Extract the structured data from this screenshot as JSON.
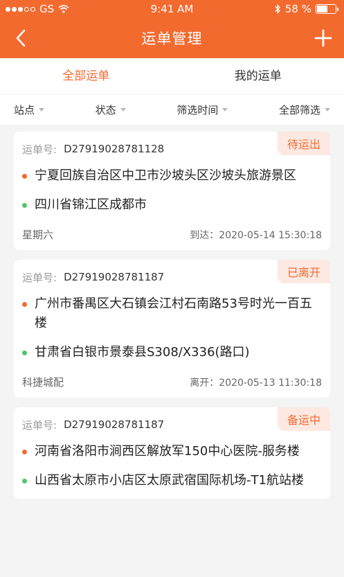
{
  "status_bar": {
    "carrier": "GS",
    "time": "9:41 AM",
    "battery": "58 %",
    "battery_level": 0.58
  },
  "nav": {
    "title": "运单管理"
  },
  "tabs": [
    {
      "label": "全部运单",
      "active": true
    },
    {
      "label": "我的运单",
      "active": false
    }
  ],
  "filters": [
    {
      "label": "站点"
    },
    {
      "label": "状态"
    },
    {
      "label": "筛选时间"
    },
    {
      "label": "全部筛选"
    }
  ],
  "colors": {
    "accent": "#f36a2f",
    "from_dot": "#f36a2f",
    "to_dot": "#4cc964",
    "badge_bg": "#fde9e1"
  },
  "orders": [
    {
      "number_label": "运单号:",
      "number": "D27919028781128",
      "status": "待运出",
      "from": "宁夏回族自治区中卫市沙坡头区沙坡头旅游景区",
      "to": "四川省锦江区成都市",
      "foot_left": "星期六",
      "foot_right": "到达：2020-05-14 15:30:18"
    },
    {
      "number_label": "运单号:",
      "number": "D27919028781187",
      "status": "已离开",
      "from": "广州市番禺区大石镇会江村石南路53号时光一百五楼",
      "to": "甘肃省白银市景泰县S308/X336(路口)",
      "foot_left": "科捷城配",
      "foot_right": "离开：2020-05-13 11:30:18"
    },
    {
      "number_label": "运单号:",
      "number": "D27919028781187",
      "status": "备运中",
      "from": "河南省洛阳市涧西区解放军150中心医院-服务楼",
      "to": "山西省太原市小店区太原武宿国际机场-T1航站楼",
      "foot_left": "",
      "foot_right": ""
    }
  ]
}
